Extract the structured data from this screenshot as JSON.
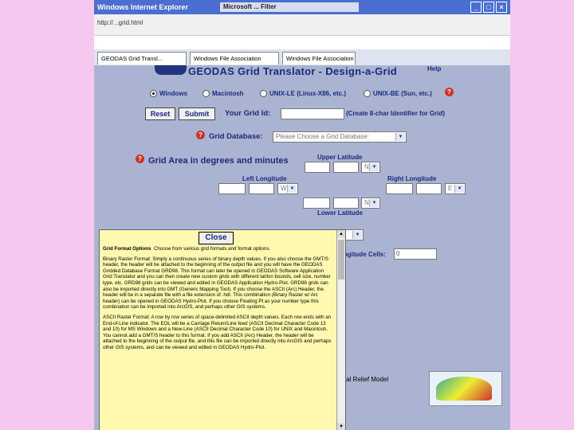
{
  "browser": {
    "title": "Windows Internet Explorer",
    "tray_text": "Microsoft ... Filter",
    "address": "http://...grid.html",
    "tabs": [
      "GEODAS Grid Transl...",
      "Windows File Association",
      "Windows File Association"
    ]
  },
  "page": {
    "title": "GEODAS Grid Translator - Design-a-Grid",
    "help_label": "Help",
    "platforms": [
      {
        "label": "Windows",
        "selected": true
      },
      {
        "label": "Macintosh",
        "selected": false
      },
      {
        "label": "UNIX-LE (Linux-X86, etc.)",
        "selected": false
      },
      {
        "label": "UNIX-BE (Sun, etc.)",
        "selected": false
      }
    ],
    "reset_label": "Reset",
    "submit_label": "Submit",
    "grid_id_label": "Your Grid Id:",
    "grid_id_hint": "(Create 8-char Identifier for Grid)",
    "grid_db_label": "Grid Database:",
    "grid_db_placeholder": "Please Choose a Grid Database:",
    "grid_area_label": "Grid Area in degrees and minutes",
    "upper_latitude": "Upper Latitude",
    "lower_latitude": "Lower Latitude",
    "left_longitude": "Left Longitude",
    "right_longitude": "Right Longitude",
    "hemi_n": "N",
    "hemi_w": "W",
    "hemi_e": "E",
    "longitude_cells_label": "ongitude Cells:",
    "longitude_cells_value": "0",
    "relief_label": "stal Relief Model"
  },
  "popup": {
    "close_label": "Close",
    "heading": "Grid Format Options",
    "heading_desc": "Choose from various grid formats and format options.",
    "para1": "Binary Raster Format: Simply a continuous series of binary depth values. If you also choose the GMT/S header, the header will be attached to the beginning of the output file and you will have the GEODAS Gridded Database Format GRD98. This format can later be opened in GEODAS Software Application Grid Translator and you can then create new custom grids with different lat/lon bounds, cell size, number type, etc. GRD98 grids can be viewed and edited in GEODAS Application Hydro-Plot. GRD98 grids can also be imported directly into GMT (Generic Mapping Tool). If you choose the ASCII (Arc) Header, the header will be in a separate file with a file extension of .hdr. This combination (Binary Raster w/ Arc header) can be opened in GEODAS Hydro-Plot. If you choose Floating Pt as your number type this combination can be imported into ArcGIS, and perhaps other GIS systems.",
    "para2": "ASCII Raster Format: A row by row series of space-delimited ASCII depth values. Each row ends with an End-of-Line indicator. The EOL will be a Carriage Return/Line feed (ASCII Decimal Character Code 13 and 10) for MS Windows and a New-Line (ASCII Decimal Character Code 10) for UNIX and Macintosh. You cannot add a GMT/S header to this format. If you add ASCII (Arc) Header, the header will be attached to the beginning of the output file, and this file can be imported directly into ArcGIS and perhaps other GIS systems, and can be viewed and edited in GEODAS Hydro-Plot."
  }
}
